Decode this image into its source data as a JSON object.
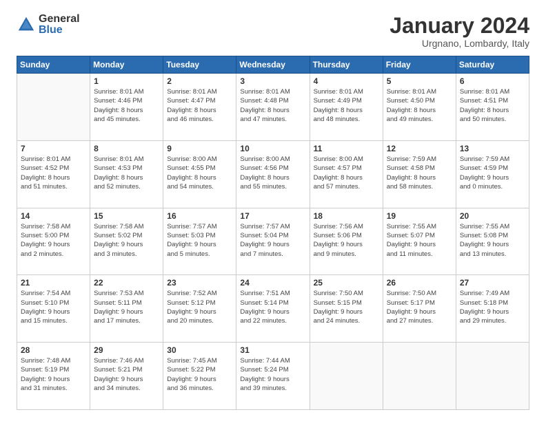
{
  "logo": {
    "general": "General",
    "blue": "Blue"
  },
  "header": {
    "month": "January 2024",
    "location": "Urgnano, Lombardy, Italy"
  },
  "weekdays": [
    "Sunday",
    "Monday",
    "Tuesday",
    "Wednesday",
    "Thursday",
    "Friday",
    "Saturday"
  ],
  "weeks": [
    [
      {
        "day": "",
        "info": ""
      },
      {
        "day": "1",
        "info": "Sunrise: 8:01 AM\nSunset: 4:46 PM\nDaylight: 8 hours\nand 45 minutes."
      },
      {
        "day": "2",
        "info": "Sunrise: 8:01 AM\nSunset: 4:47 PM\nDaylight: 8 hours\nand 46 minutes."
      },
      {
        "day": "3",
        "info": "Sunrise: 8:01 AM\nSunset: 4:48 PM\nDaylight: 8 hours\nand 47 minutes."
      },
      {
        "day": "4",
        "info": "Sunrise: 8:01 AM\nSunset: 4:49 PM\nDaylight: 8 hours\nand 48 minutes."
      },
      {
        "day": "5",
        "info": "Sunrise: 8:01 AM\nSunset: 4:50 PM\nDaylight: 8 hours\nand 49 minutes."
      },
      {
        "day": "6",
        "info": "Sunrise: 8:01 AM\nSunset: 4:51 PM\nDaylight: 8 hours\nand 50 minutes."
      }
    ],
    [
      {
        "day": "7",
        "info": "Sunrise: 8:01 AM\nSunset: 4:52 PM\nDaylight: 8 hours\nand 51 minutes."
      },
      {
        "day": "8",
        "info": "Sunrise: 8:01 AM\nSunset: 4:53 PM\nDaylight: 8 hours\nand 52 minutes."
      },
      {
        "day": "9",
        "info": "Sunrise: 8:00 AM\nSunset: 4:55 PM\nDaylight: 8 hours\nand 54 minutes."
      },
      {
        "day": "10",
        "info": "Sunrise: 8:00 AM\nSunset: 4:56 PM\nDaylight: 8 hours\nand 55 minutes."
      },
      {
        "day": "11",
        "info": "Sunrise: 8:00 AM\nSunset: 4:57 PM\nDaylight: 8 hours\nand 57 minutes."
      },
      {
        "day": "12",
        "info": "Sunrise: 7:59 AM\nSunset: 4:58 PM\nDaylight: 8 hours\nand 58 minutes."
      },
      {
        "day": "13",
        "info": "Sunrise: 7:59 AM\nSunset: 4:59 PM\nDaylight: 9 hours\nand 0 minutes."
      }
    ],
    [
      {
        "day": "14",
        "info": "Sunrise: 7:58 AM\nSunset: 5:00 PM\nDaylight: 9 hours\nand 2 minutes."
      },
      {
        "day": "15",
        "info": "Sunrise: 7:58 AM\nSunset: 5:02 PM\nDaylight: 9 hours\nand 3 minutes."
      },
      {
        "day": "16",
        "info": "Sunrise: 7:57 AM\nSunset: 5:03 PM\nDaylight: 9 hours\nand 5 minutes."
      },
      {
        "day": "17",
        "info": "Sunrise: 7:57 AM\nSunset: 5:04 PM\nDaylight: 9 hours\nand 7 minutes."
      },
      {
        "day": "18",
        "info": "Sunrise: 7:56 AM\nSunset: 5:06 PM\nDaylight: 9 hours\nand 9 minutes."
      },
      {
        "day": "19",
        "info": "Sunrise: 7:55 AM\nSunset: 5:07 PM\nDaylight: 9 hours\nand 11 minutes."
      },
      {
        "day": "20",
        "info": "Sunrise: 7:55 AM\nSunset: 5:08 PM\nDaylight: 9 hours\nand 13 minutes."
      }
    ],
    [
      {
        "day": "21",
        "info": "Sunrise: 7:54 AM\nSunset: 5:10 PM\nDaylight: 9 hours\nand 15 minutes."
      },
      {
        "day": "22",
        "info": "Sunrise: 7:53 AM\nSunset: 5:11 PM\nDaylight: 9 hours\nand 17 minutes."
      },
      {
        "day": "23",
        "info": "Sunrise: 7:52 AM\nSunset: 5:12 PM\nDaylight: 9 hours\nand 20 minutes."
      },
      {
        "day": "24",
        "info": "Sunrise: 7:51 AM\nSunset: 5:14 PM\nDaylight: 9 hours\nand 22 minutes."
      },
      {
        "day": "25",
        "info": "Sunrise: 7:50 AM\nSunset: 5:15 PM\nDaylight: 9 hours\nand 24 minutes."
      },
      {
        "day": "26",
        "info": "Sunrise: 7:50 AM\nSunset: 5:17 PM\nDaylight: 9 hours\nand 27 minutes."
      },
      {
        "day": "27",
        "info": "Sunrise: 7:49 AM\nSunset: 5:18 PM\nDaylight: 9 hours\nand 29 minutes."
      }
    ],
    [
      {
        "day": "28",
        "info": "Sunrise: 7:48 AM\nSunset: 5:19 PM\nDaylight: 9 hours\nand 31 minutes."
      },
      {
        "day": "29",
        "info": "Sunrise: 7:46 AM\nSunset: 5:21 PM\nDaylight: 9 hours\nand 34 minutes."
      },
      {
        "day": "30",
        "info": "Sunrise: 7:45 AM\nSunset: 5:22 PM\nDaylight: 9 hours\nand 36 minutes."
      },
      {
        "day": "31",
        "info": "Sunrise: 7:44 AM\nSunset: 5:24 PM\nDaylight: 9 hours\nand 39 minutes."
      },
      {
        "day": "",
        "info": ""
      },
      {
        "day": "",
        "info": ""
      },
      {
        "day": "",
        "info": ""
      }
    ]
  ]
}
